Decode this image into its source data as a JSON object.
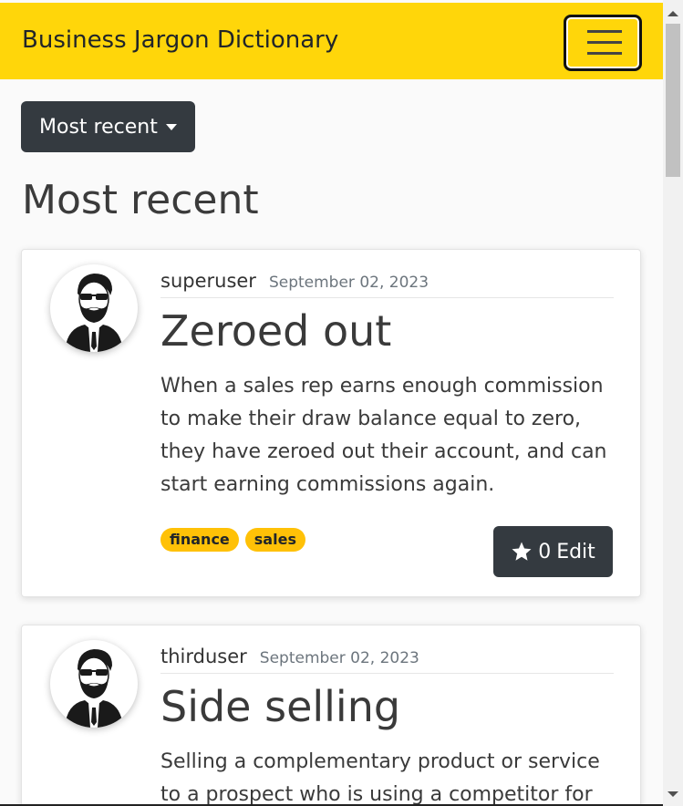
{
  "navbar": {
    "brand": "Business Jargon Dictionary",
    "toggler_icon": "hamburger-icon",
    "color": "#ffd60a"
  },
  "sort": {
    "label": "Most recent",
    "icon": "caret-down-icon"
  },
  "page_heading": "Most recent",
  "posts": [
    {
      "username": "superuser",
      "date": "September 02, 2023",
      "title": "Zeroed out",
      "description": "When a sales rep earns enough commission to make their draw balance equal to zero, they have zeroed out their account, and can start earning commissions again.",
      "tags": [
        "finance",
        "sales"
      ],
      "stars": "0",
      "edit_label": "Edit",
      "avatar_icon": "user-avatar-icon"
    },
    {
      "username": "thirduser",
      "date": "September 02, 2023",
      "title": "Side selling",
      "description": "Selling a complementary product or service to a prospect who is using a competitor for",
      "avatar_icon": "user-avatar-icon"
    }
  ],
  "colors": {
    "tag": "#ffc107",
    "dark_button": "#343a40"
  }
}
